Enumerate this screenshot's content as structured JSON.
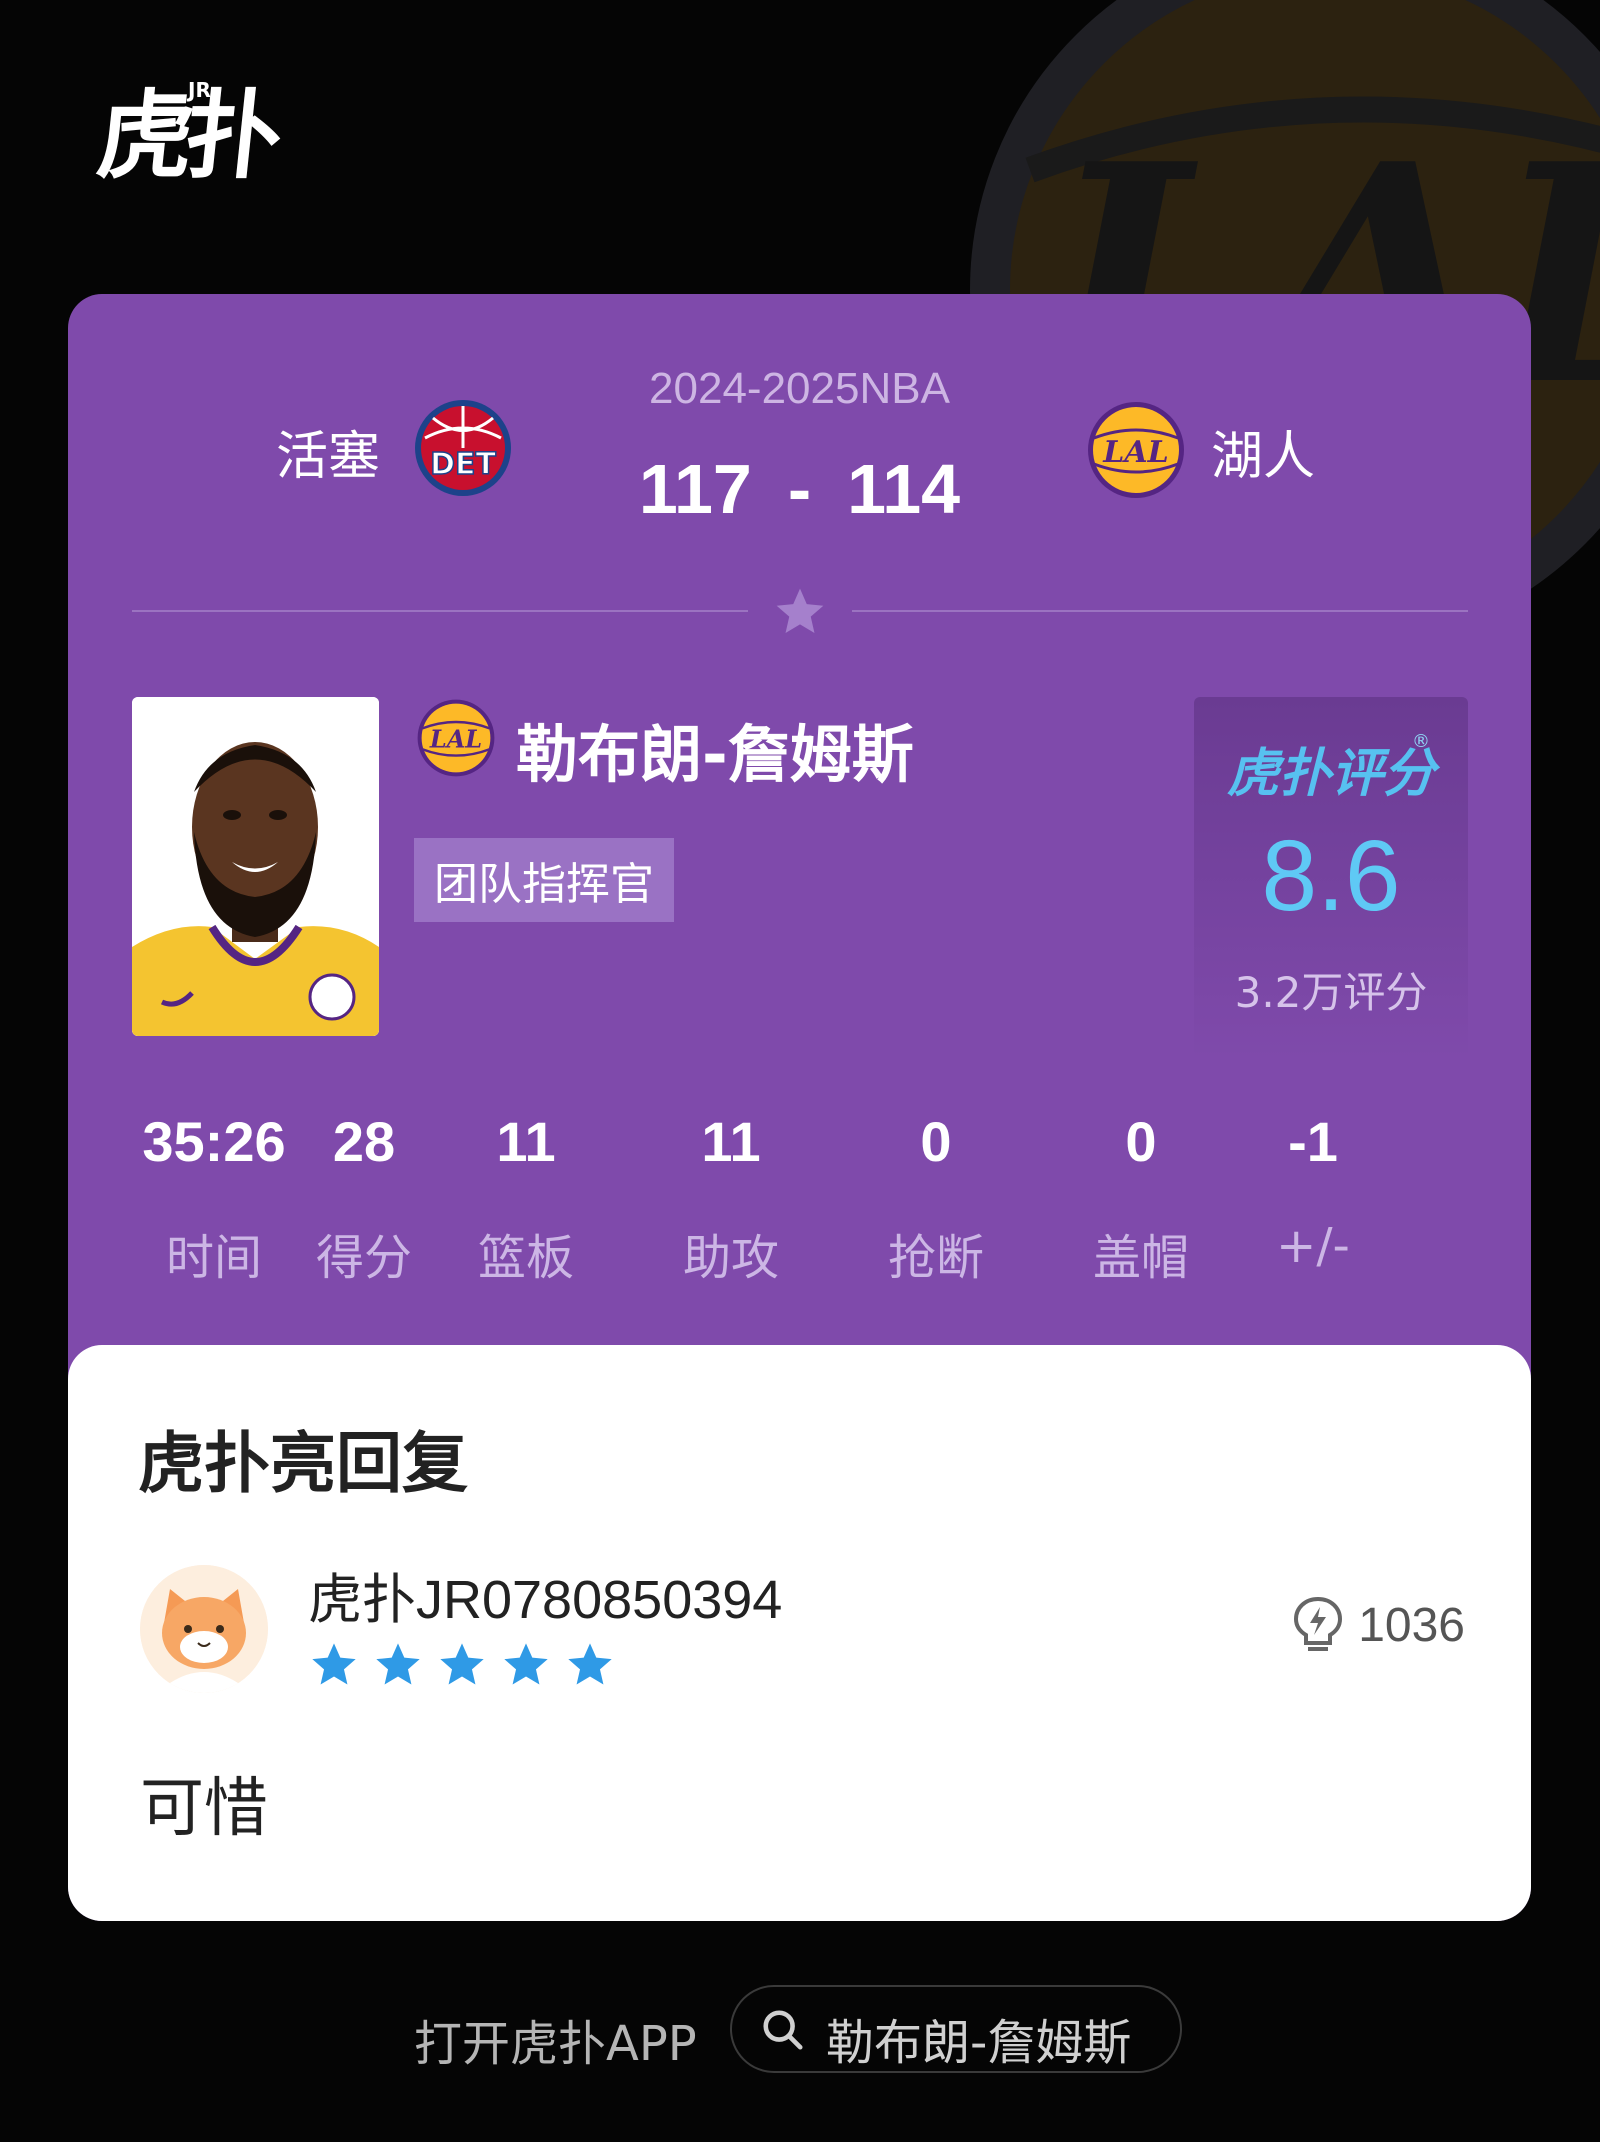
{
  "brand": {
    "main": "虎扑",
    "jr": "JR"
  },
  "game": {
    "season": "2024-2025NBA",
    "home_team": "活塞",
    "away_team": "湖人",
    "home_score": "117",
    "separator": "-",
    "away_score": "114",
    "home_logo_text": "DET",
    "away_logo_text": "LAL"
  },
  "player": {
    "name": "勒布朗-詹姆斯",
    "role_tag": "团队指挥官"
  },
  "rating": {
    "brand": "虎扑评分",
    "score": "8.6",
    "count": "3.2万评分"
  },
  "stats": [
    {
      "value": "35:26",
      "label": "时间"
    },
    {
      "value": "28",
      "label": "得分"
    },
    {
      "value": "11",
      "label": "篮板"
    },
    {
      "value": "11",
      "label": "助攻"
    },
    {
      "value": "0",
      "label": "抢断"
    },
    {
      "value": "0",
      "label": "盖帽"
    },
    {
      "value": "-1",
      "label": "+/-"
    }
  ],
  "reply": {
    "title": "虎扑亮回复",
    "username": "虎扑JR0780850394",
    "stars": 5,
    "likes": "1036",
    "text": "可惜"
  },
  "footer": {
    "open_app": "打开虎扑APP",
    "search_text": "勒布朗-詹姆斯"
  },
  "colors": {
    "card": "#7f4aab",
    "rating": "#5fc9f5",
    "star": "#2f9ae6",
    "background": "#050505"
  }
}
